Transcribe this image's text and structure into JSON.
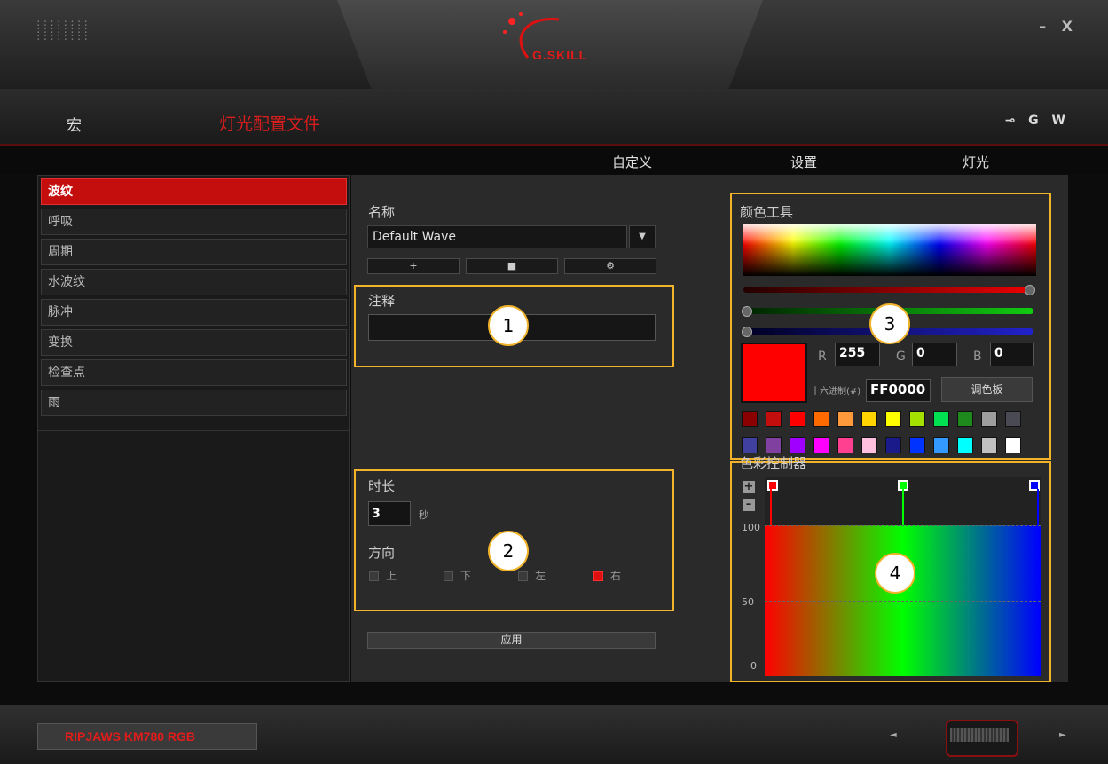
{
  "window": {
    "minimize": "–",
    "close": "X"
  },
  "brand": {
    "logo_dots": "::::::::\n::::::::\n::::::::",
    "logo_text": "G.SKILL"
  },
  "nav": {
    "macro": "宏",
    "lighting_profile": "灯光配置文件",
    "icons": [
      "⊸",
      "G",
      "W"
    ]
  },
  "tabs": [
    "自定义",
    "设置",
    "灯光"
  ],
  "effects": [
    "波纹",
    "呼吸",
    "周期",
    "水波纹",
    "脉冲",
    "变换",
    "检查点",
    "雨"
  ],
  "active_effect": "波纹",
  "name": {
    "label": "名称",
    "value": "Default Wave",
    "dropdown": "▼",
    "buttons": [
      "+",
      "■",
      "⚙"
    ]
  },
  "note": {
    "label": "注释",
    "value": ""
  },
  "duration": {
    "label": "时长",
    "value": "3",
    "unit": "秒"
  },
  "direction": {
    "label": "方向",
    "options": [
      "上",
      "下",
      "左",
      "右"
    ],
    "selected": "右"
  },
  "apply_label": "应用",
  "color_tool": {
    "label": "颜色工具",
    "r_label": "R",
    "r": "255",
    "g_label": "G",
    "g": "0",
    "b_label": "B",
    "b": "0",
    "hex_label": "十六进制(#)",
    "hex": "FF0000",
    "palette_button": "调色板",
    "current_color": "#ff0000",
    "swatches": [
      "#8b0000",
      "#c40d0d",
      "#ff0000",
      "#ff6a00",
      "#ff9a3c",
      "#ffd400",
      "#ffff00",
      "#a4e000",
      "#00e050",
      "#1e8a1e",
      "#9e9e9e",
      "#4a4a55",
      "#4040a0",
      "#8040a0",
      "#a000ff",
      "#ff00ff",
      "#ff4090",
      "#ffc0e0",
      "#1a1a8a",
      "#0033ff",
      "#3399ff",
      "#00ffff",
      "#c0c0c0",
      "#ffffff"
    ]
  },
  "color_controller": {
    "label": "色彩控制器",
    "add": "+",
    "remove": "–",
    "y_labels": [
      "100",
      "50",
      "0"
    ],
    "stops": [
      "#ff0000",
      "#00ff00",
      "#0000ff"
    ]
  },
  "badges": [
    "1",
    "2",
    "3",
    "4"
  ],
  "bottom": {
    "device": "RIPJAWS KM780 RGB",
    "prev": "◄",
    "next": "►"
  }
}
